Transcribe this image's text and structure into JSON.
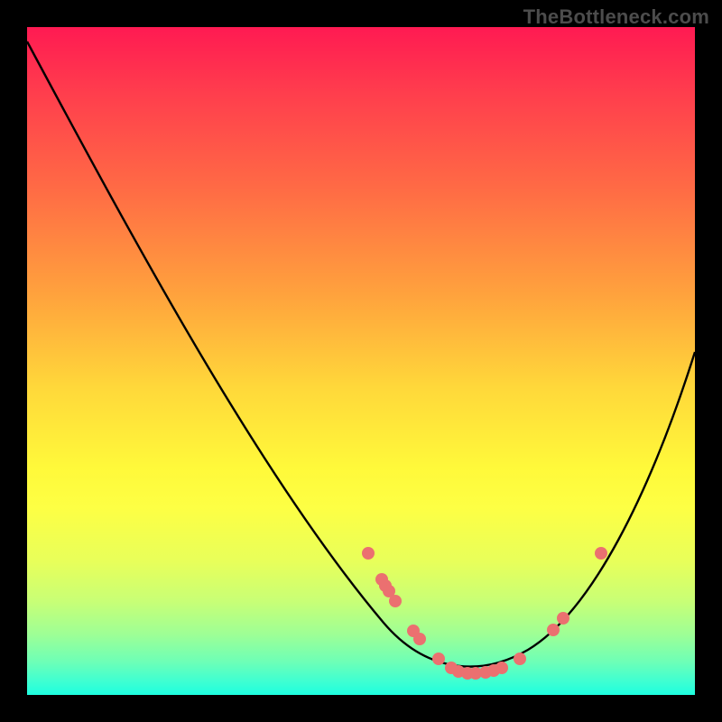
{
  "watermark": "TheBottleneck.com",
  "chart_data": {
    "type": "line",
    "title": "",
    "xlabel": "",
    "ylabel": "",
    "xlim": [
      0,
      100
    ],
    "ylim": [
      0,
      100
    ],
    "grid": false,
    "legend": false,
    "background_gradient": {
      "stops": [
        {
          "pos": 0,
          "color": "#ff1a52"
        },
        {
          "pos": 24,
          "color": "#ff6a45"
        },
        {
          "pos": 54,
          "color": "#ffd83a"
        },
        {
          "pos": 72,
          "color": "#fdff44"
        },
        {
          "pos": 91,
          "color": "#9dff96"
        },
        {
          "pos": 100,
          "color": "#1effe0"
        }
      ]
    },
    "series": [
      {
        "name": "curve",
        "kind": "smooth-line",
        "color": "#000000",
        "x": [
          0,
          16,
          35,
          53,
          59,
          68,
          75,
          88,
          100
        ],
        "y": [
          98,
          68,
          32,
          11,
          4,
          3,
          7,
          23,
          51
        ]
      },
      {
        "name": "highlight-points",
        "kind": "scatter",
        "color": "#eb7070",
        "x": [
          51,
          53,
          54,
          54,
          55,
          58,
          59,
          62,
          64,
          65,
          66,
          67,
          69,
          70,
          71,
          74,
          79,
          80,
          86
        ],
        "y": [
          21,
          17,
          16,
          16,
          14,
          10,
          8,
          5,
          4,
          4,
          3,
          3,
          3,
          4,
          4,
          5,
          10,
          11,
          21
        ]
      }
    ]
  }
}
